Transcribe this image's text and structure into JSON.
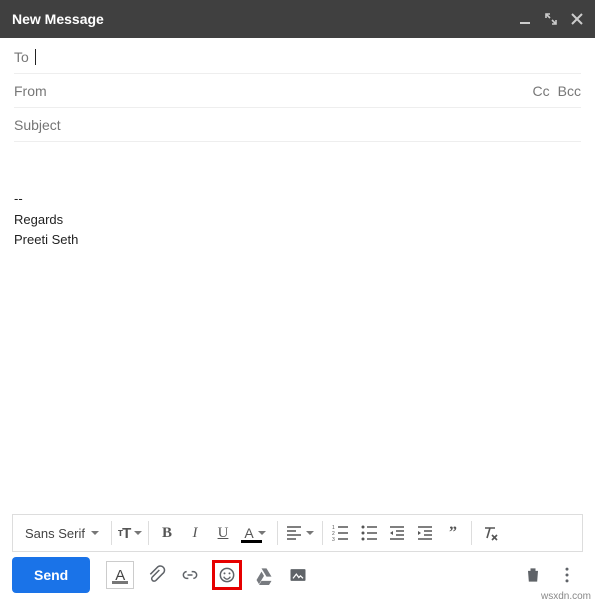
{
  "header": {
    "title": "New Message"
  },
  "fields": {
    "to_label": "To",
    "to_value": "",
    "from_label": "From",
    "from_value": "",
    "cc_label": "Cc",
    "bcc_label": "Bcc",
    "subject_placeholder": "Subject",
    "subject_value": ""
  },
  "body": {
    "sig_divider": "--",
    "line1": "Regards",
    "line2": "",
    "line3": "Preeti Seth"
  },
  "formatting_toolbar": {
    "font_family": "Sans Serif"
  },
  "send_bar": {
    "send_label": "Send"
  },
  "credit": "wsxdn.com"
}
